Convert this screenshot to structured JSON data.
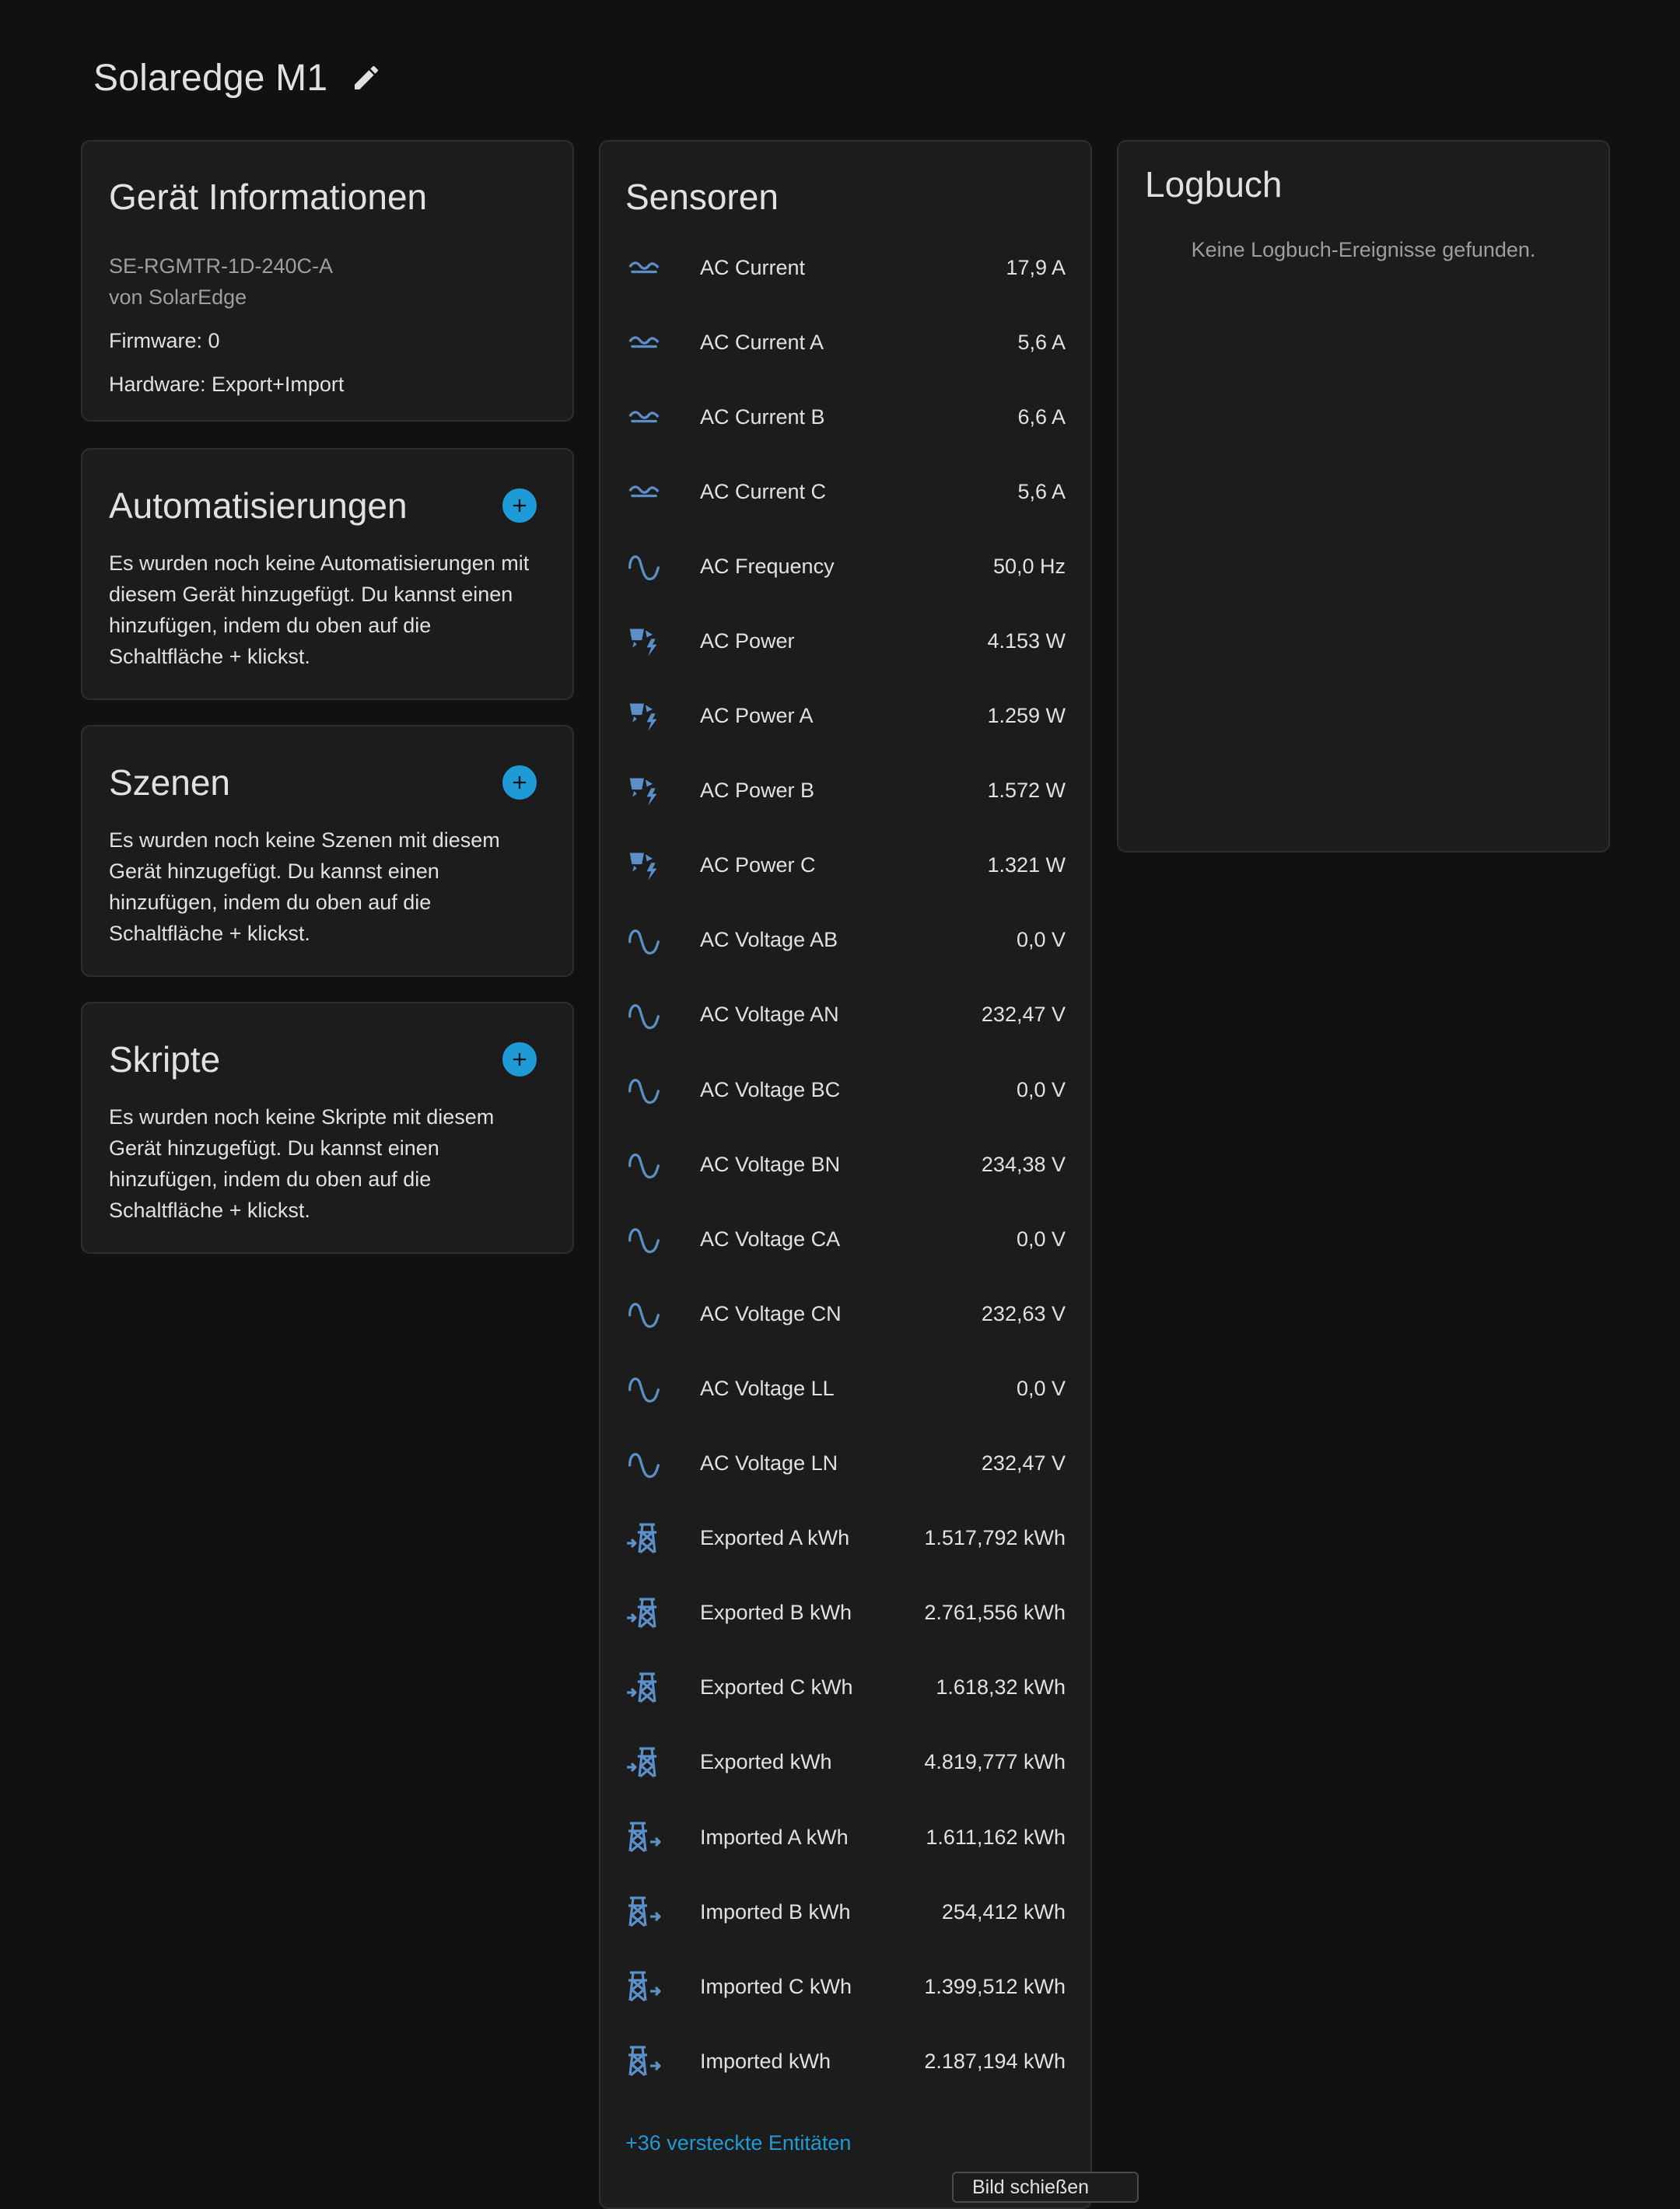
{
  "header": {
    "title": "Solaredge M1"
  },
  "device_info": {
    "title": "Gerät Informationen",
    "model": "SE-RGMTR-1D-240C-A",
    "manufacturer": "von SolarEdge",
    "firmware": "Firmware: 0",
    "hardware": "Hardware: Export+Import"
  },
  "automations": {
    "title": "Automatisierungen",
    "text": "Es wurden noch keine Automatisierungen mit diesem Gerät hinzugefügt. Du kannst einen hinzufügen, indem du oben auf die Schaltfläche + klickst."
  },
  "scenes": {
    "title": "Szenen",
    "text": "Es wurden noch keine Szenen mit diesem Gerät hinzugefügt. Du kannst einen hinzufügen, indem du oben auf die Schaltfläche + klickst."
  },
  "scripts": {
    "title": "Skripte",
    "text": "Es wurden noch keine Skripte mit diesem Gerät hinzugefügt. Du kannst einen hinzufügen, indem du oben auf die Schaltfläche + klickst."
  },
  "sensors": {
    "title": "Sensoren",
    "items": [
      {
        "name": "AC Current",
        "value": "17,9 A",
        "icon": "current-ac-icon"
      },
      {
        "name": "AC Current A",
        "value": "5,6 A",
        "icon": "current-ac-icon"
      },
      {
        "name": "AC Current B",
        "value": "6,6 A",
        "icon": "current-ac-icon"
      },
      {
        "name": "AC Current C",
        "value": "5,6 A",
        "icon": "current-ac-icon"
      },
      {
        "name": "AC Frequency",
        "value": "50,0 Hz",
        "icon": "sine-wave-icon"
      },
      {
        "name": "AC Power",
        "value": "4.153 W",
        "icon": "solar-power-icon"
      },
      {
        "name": "AC Power A",
        "value": "1.259 W",
        "icon": "solar-power-icon"
      },
      {
        "name": "AC Power B",
        "value": "1.572 W",
        "icon": "solar-power-icon"
      },
      {
        "name": "AC Power C",
        "value": "1.321 W",
        "icon": "solar-power-icon"
      },
      {
        "name": "AC Voltage AB",
        "value": "0,0 V",
        "icon": "sine-wave-icon"
      },
      {
        "name": "AC Voltage AN",
        "value": "232,47 V",
        "icon": "sine-wave-icon"
      },
      {
        "name": "AC Voltage BC",
        "value": "0,0 V",
        "icon": "sine-wave-icon"
      },
      {
        "name": "AC Voltage BN",
        "value": "234,38 V",
        "icon": "sine-wave-icon"
      },
      {
        "name": "AC Voltage CA",
        "value": "0,0 V",
        "icon": "sine-wave-icon"
      },
      {
        "name": "AC Voltage CN",
        "value": "232,63 V",
        "icon": "sine-wave-icon"
      },
      {
        "name": "AC Voltage LL",
        "value": "0,0 V",
        "icon": "sine-wave-icon"
      },
      {
        "name": "AC Voltage LN",
        "value": "232,47 V",
        "icon": "sine-wave-icon"
      },
      {
        "name": "Exported A kWh",
        "value": "1.517,792 kWh",
        "icon": "transmission-tower-export-icon"
      },
      {
        "name": "Exported B kWh",
        "value": "2.761,556 kWh",
        "icon": "transmission-tower-export-icon"
      },
      {
        "name": "Exported C kWh",
        "value": "1.618,32 kWh",
        "icon": "transmission-tower-export-icon"
      },
      {
        "name": "Exported kWh",
        "value": "4.819,777 kWh",
        "icon": "transmission-tower-export-icon"
      },
      {
        "name": "Imported A kWh",
        "value": "1.611,162 kWh",
        "icon": "transmission-tower-import-icon"
      },
      {
        "name": "Imported B kWh",
        "value": "254,412 kWh",
        "icon": "transmission-tower-import-icon"
      },
      {
        "name": "Imported C kWh",
        "value": "1.399,512 kWh",
        "icon": "transmission-tower-import-icon"
      },
      {
        "name": "Imported kWh",
        "value": "2.187,194 kWh",
        "icon": "transmission-tower-import-icon"
      }
    ],
    "hidden_entities": "+36 versteckte Entitäten"
  },
  "tooltip": "Bild schießen",
  "logbook": {
    "title": "Logbuch",
    "empty_text": "Keine Logbuch-Ereignisse gefunden."
  },
  "colors": {
    "accent": "#1e9bd7",
    "icon": "#5b8fc7",
    "background": "#111111",
    "card": "#1c1c1c"
  }
}
